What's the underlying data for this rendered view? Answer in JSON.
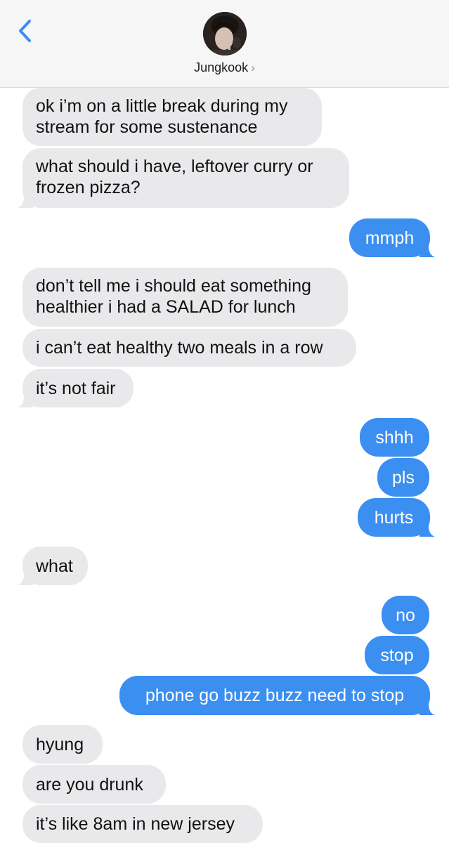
{
  "header": {
    "contact_name": "Jungkook",
    "chevron": "›",
    "back_icon": "chevron-left-icon",
    "accent_color": "#3b8ff0"
  },
  "colors": {
    "incoming_bubble": "#e9e9eb",
    "outgoing_bubble": "#3b8ff0",
    "header_background": "#f6f6f7"
  },
  "messages": [
    {
      "direction": "in",
      "text": "ok i’m on a little break during my\nstream for some sustenance",
      "tail": false
    },
    {
      "direction": "in",
      "text": "what should i have, leftover curry or\nfrozen pizza?",
      "tail": true
    },
    {
      "direction": "out",
      "text": "mmph",
      "tail": true
    },
    {
      "direction": "in",
      "text": "don’t tell me i should eat something\nhealthier i had a SALAD for lunch",
      "tail": false
    },
    {
      "direction": "in",
      "text": "i can’t eat healthy two meals in a row",
      "tail": false
    },
    {
      "direction": "in",
      "text": "it’s not fair",
      "tail": true
    },
    {
      "direction": "out",
      "text": "shhh",
      "tail": false
    },
    {
      "direction": "out",
      "text": "pls",
      "tail": false
    },
    {
      "direction": "out",
      "text": "hurts",
      "tail": true
    },
    {
      "direction": "in",
      "text": "what",
      "tail": true
    },
    {
      "direction": "out",
      "text": "no",
      "tail": false
    },
    {
      "direction": "out",
      "text": "stop",
      "tail": false
    },
    {
      "direction": "out",
      "text": "phone go buzz buzz need to stop",
      "tail": true
    },
    {
      "direction": "in",
      "text": "hyung",
      "tail": false
    },
    {
      "direction": "in",
      "text": "are you drunk",
      "tail": false
    },
    {
      "direction": "in",
      "text": "it’s like 8am in new jersey",
      "tail": false
    }
  ]
}
